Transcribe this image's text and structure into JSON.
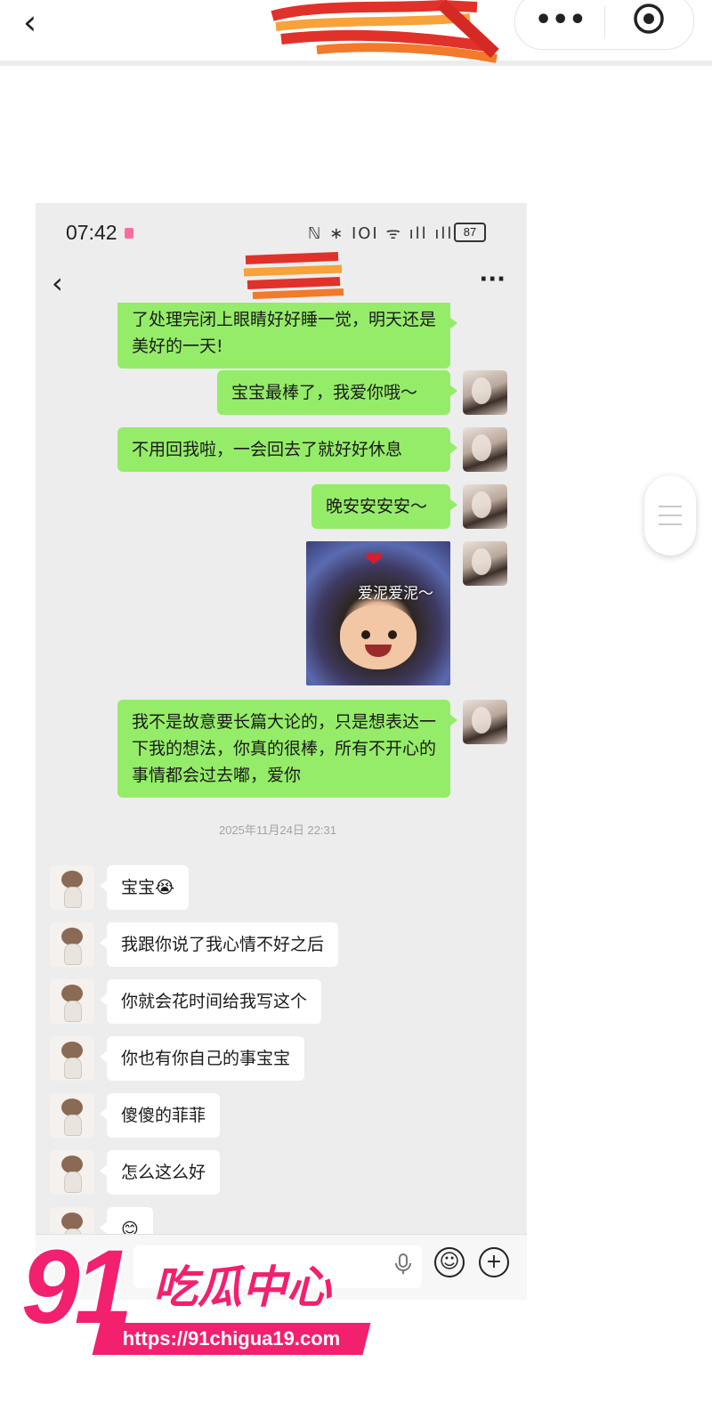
{
  "outer_bar": {
    "back_glyph": "‹",
    "more_glyph": "•••"
  },
  "status_bar": {
    "time": "07:42",
    "icons_text": "ℕ ∗ ⅠOⅠ ᯤ ıll ıll",
    "battery": "87"
  },
  "chat_header": {
    "back_glyph": "‹",
    "more_glyph": "···"
  },
  "messages_me": [
    {
      "text": "了处理完闭上眼睛好好睡一觉，明天还是美好的一天!"
    },
    {
      "text": "宝宝最棒了，我爱你哦～"
    },
    {
      "text": "不用回我啦，一会回去了就好好休息"
    },
    {
      "text": "晚安安安安～"
    },
    {
      "text": "我不是故意要长篇大论的，只是想表达一下我的想法，你真的很棒，所有不开心的事情都会过去嘟，爱你"
    }
  ],
  "sticker": {
    "caption": "爱泥爱泥～",
    "icon": "heart-icon"
  },
  "timestamp": "2025年11月24日 22:31",
  "messages_them": [
    {
      "text": "宝宝😭"
    },
    {
      "text": "我跟你说了我心情不好之后"
    },
    {
      "text": "你就会花时间给我写这个"
    },
    {
      "text": "你也有你自己的事宝宝"
    },
    {
      "text": "傻傻的菲菲"
    },
    {
      "text": "怎么这么好"
    },
    {
      "text": "😊"
    }
  ],
  "input_bar": {
    "mic_icon": "microphone-icon",
    "emoji_glyph": "☺",
    "plus_glyph": "+"
  },
  "watermark": {
    "number": "91",
    "brand": "吃瓜中心",
    "url": "https://91chigua19.com"
  },
  "colors": {
    "my_bubble": "#95ec69",
    "their_bubble": "#ffffff",
    "chat_bg": "#ededed",
    "watermark": "#f2206e"
  }
}
